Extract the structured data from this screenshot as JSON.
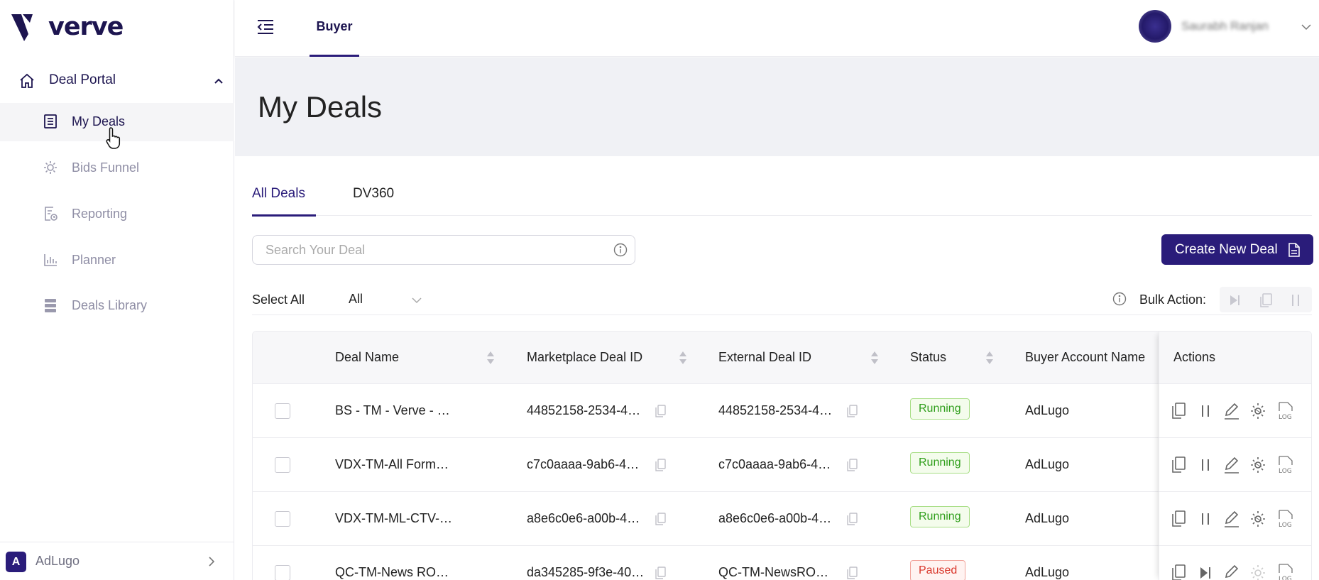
{
  "brand": {
    "name": "verve",
    "color": "#1d1550",
    "accent": "#2a1c7a"
  },
  "sidebar": {
    "section": {
      "label": "Deal Portal",
      "icon": "home-icon",
      "expanded": true
    },
    "items": [
      {
        "label": "My Deals",
        "icon": "my-deals-icon",
        "active": true
      },
      {
        "label": "Bids Funnel",
        "icon": "bids-funnel-icon",
        "active": false
      },
      {
        "label": "Reporting",
        "icon": "reporting-icon",
        "active": false
      },
      {
        "label": "Planner",
        "icon": "planner-icon",
        "active": false
      },
      {
        "label": "Deals Library",
        "icon": "deals-library-icon",
        "active": false
      }
    ],
    "account": {
      "initial": "A",
      "name": "AdLugo"
    }
  },
  "header": {
    "tab": "Buyer",
    "user_name": "Saurabh Ranjan"
  },
  "page": {
    "title": "My Deals"
  },
  "tabs": [
    {
      "label": "All Deals",
      "active": true
    },
    {
      "label": "DV360",
      "active": false
    }
  ],
  "search": {
    "placeholder": "Search Your Deal",
    "value": ""
  },
  "create_button": {
    "label": "Create New Deal"
  },
  "toolbar": {
    "select_all_label": "Select All",
    "filter_value": "All",
    "bulk_action_label": "Bulk Action:"
  },
  "table": {
    "columns": [
      "Deal Name",
      "Marketplace Deal ID",
      "External Deal ID",
      "Status",
      "Buyer Account Name",
      "Actions"
    ],
    "rows": [
      {
        "deal_name": "BS - TM - Verve - …",
        "marketplace_id": "44852158-2534-4…",
        "external_id": "44852158-2534-4…",
        "status": "Running",
        "buyer": "AdLugo",
        "paused": false
      },
      {
        "deal_name": "VDX-TM-All Form…",
        "marketplace_id": "c7c0aaaa-9ab6-4…",
        "external_id": "c7c0aaaa-9ab6-4…",
        "status": "Running",
        "buyer": "AdLugo",
        "paused": false
      },
      {
        "deal_name": "VDX-TM-ML-CTV-…",
        "marketplace_id": "a8e6c0e6-a00b-4…",
        "external_id": "a8e6c0e6-a00b-4…",
        "status": "Running",
        "buyer": "AdLugo",
        "paused": false
      },
      {
        "deal_name": "QC-TM-News RO…",
        "marketplace_id": "da345285-9f3e-40…",
        "external_id": "QC-TM-NewsRO…",
        "status": "Paused",
        "buyer": "AdLugo",
        "paused": true
      }
    ]
  },
  "colors": {
    "running": "#2e9e1a",
    "paused": "#d9362a"
  }
}
